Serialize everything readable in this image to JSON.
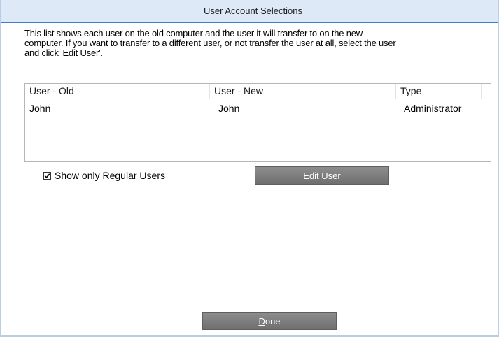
{
  "window": {
    "title": "User Account Selections"
  },
  "description": {
    "line1": "This list shows each user on the old computer and the user it will transfer to on the new",
    "line2": "computer. If you want to transfer to a different user, or not transfer the user at all, select the user",
    "line3": "and click 'Edit User'."
  },
  "list": {
    "columns": [
      "User - Old",
      "User - New",
      "Type",
      ""
    ],
    "rows": [
      {
        "old": "John",
        "new": "John",
        "type": "Administrator"
      }
    ]
  },
  "options": {
    "show_regular": {
      "checked": true,
      "label_pre": "Show only ",
      "label_accel": "R",
      "label_post": "egular Users"
    }
  },
  "buttons": {
    "edit_accel": "E",
    "edit_rest": "dit User",
    "done_accel": "D",
    "done_rest": "one"
  },
  "colors": {
    "titlebar_bg": "#dde9f6",
    "titlebar_border": "#3f7fc2",
    "button_bg": "#7a7a7a"
  }
}
